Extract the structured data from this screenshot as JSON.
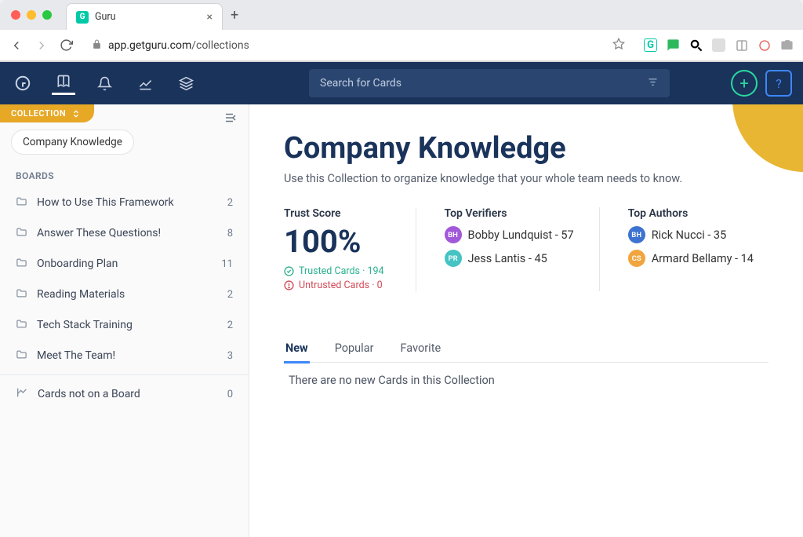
{
  "browser": {
    "tab_title": "Guru",
    "tab_favicon_letter": "G",
    "url_host": "app.getguru.com",
    "url_path": "/collections"
  },
  "search": {
    "placeholder": "Search for Cards"
  },
  "sidebar": {
    "tag": "COLLECTION",
    "collection_name": "Company Knowledge",
    "boards_header": "BOARDS",
    "boards": [
      {
        "label": "How to Use This Framework",
        "count": "2"
      },
      {
        "label": "Answer These Questions!",
        "count": "8"
      },
      {
        "label": "Onboarding Plan",
        "count": "11"
      },
      {
        "label": "Reading Materials",
        "count": "2"
      },
      {
        "label": "Tech Stack Training",
        "count": "2"
      },
      {
        "label": "Meet The Team!",
        "count": "3"
      }
    ],
    "unassigned": {
      "label": "Cards not on a Board",
      "count": "0"
    }
  },
  "content": {
    "title": "Company Knowledge",
    "subtitle": "Use this Collection to organize knowledge that your whole team needs to know.",
    "trust_label": "Trust Score",
    "trust_value": "100%",
    "trusted_text": "Trusted Cards · 194",
    "untrusted_text": "Untrusted Cards · 0",
    "verifiers_label": "Top Verifiers",
    "verifiers": [
      {
        "initials": "BH",
        "text": "Bobby Lundquist - 57",
        "color": "purple"
      },
      {
        "initials": "PR",
        "text": "Jess Lantis  - 45",
        "color": "teal"
      }
    ],
    "authors_label": "Top Authors",
    "authors": [
      {
        "initials": "BH",
        "text": "Rick Nucci - 35",
        "color": "blue"
      },
      {
        "initials": "CS",
        "text": "Armard Bellamy - 14",
        "color": "orange"
      }
    ],
    "tabs": [
      {
        "label": "New",
        "active": true
      },
      {
        "label": "Popular",
        "active": false
      },
      {
        "label": "Favorite",
        "active": false
      }
    ],
    "empty_msg": "There are no new Cards in this Collection"
  }
}
